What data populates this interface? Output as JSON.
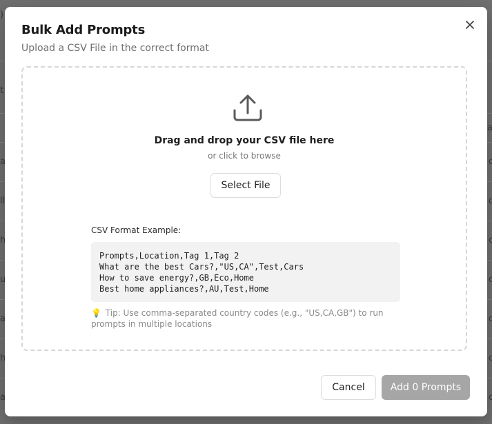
{
  "background": {
    "left_fragments": [
      ")",
      "t",
      "",
      "a",
      "ll",
      "he",
      "u",
      "a",
      "h",
      "a"
    ],
    "right_fragments": [
      "",
      "",
      "a",
      "c",
      "c",
      "c",
      "c",
      "c",
      "c",
      "c"
    ]
  },
  "modal": {
    "title": "Bulk Add Prompts",
    "subtitle": "Upload a CSV File in the correct format",
    "close_icon": "close-icon"
  },
  "dropzone": {
    "icon": "upload-icon",
    "title": "Drag and drop your CSV file here",
    "subtitle": "or click to browse",
    "select_button": "Select File"
  },
  "format_example": {
    "label": "CSV Format Example:",
    "lines": [
      "Prompts,Location,Tag 1,Tag 2",
      "What are the best Cars?,\"US,CA\",Test,Cars",
      "How to save energy?,GB,Eco,Home",
      "Best home appliances?,AU,Test,Home"
    ],
    "tip_icon": "💡",
    "tip": "Tip: Use comma-separated country codes (e.g., \"US,CA,GB\") to run prompts in multiple locations"
  },
  "footer": {
    "cancel_label": "Cancel",
    "add_label": "Add 0 Prompts"
  },
  "colors": {
    "overlay": "#6f6f6f",
    "modal_bg": "#ffffff",
    "primary_disabled": "#a6a6a6",
    "dashed_border": "#d6d6d6",
    "code_bg": "#f2f2f2"
  }
}
